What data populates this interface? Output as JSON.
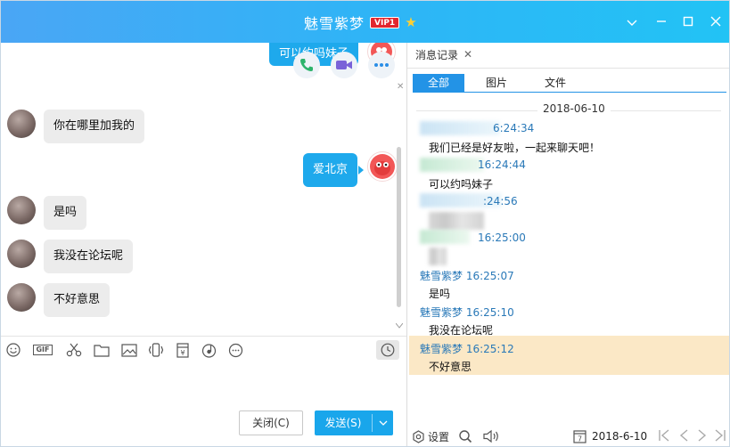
{
  "window": {
    "title": "魅雪紫梦",
    "vip_badge": "VIP1",
    "star_icon": "star-icon",
    "controls": [
      "chevron-down-icon",
      "minimize-icon",
      "maximize-icon",
      "close-icon"
    ]
  },
  "chat": {
    "call_buttons": [
      "phone-icon",
      "video-icon",
      "more-icon"
    ],
    "partial_top_message": "可以约吗妹子",
    "messages": [
      {
        "side": "left",
        "text": "你在哪里加我的"
      },
      {
        "side": "right",
        "text": "爱北京"
      },
      {
        "side": "left",
        "text": "是吗"
      },
      {
        "side": "left",
        "text": "我没在论坛呢"
      },
      {
        "side": "left",
        "text": "不好意思"
      }
    ]
  },
  "toolbar": {
    "icons": [
      "emoji-icon",
      "gif-icon",
      "scissors-icon",
      "folder-icon",
      "image-icon",
      "shake-icon",
      "red-packet-icon",
      "music-icon",
      "more-icon",
      "clock-icon"
    ],
    "gif_label": "GIF"
  },
  "input": {
    "close_label": "关闭(C)",
    "send_label": "发送(S)"
  },
  "history": {
    "tab_label": "消息记录",
    "filters": [
      "全部",
      "图片",
      "文件"
    ],
    "active_filter": "全部",
    "date_header": "2018-06-10",
    "entries": [
      {
        "sender": "",
        "time": "6:24:34",
        "content": "我们已经是好友啦，一起来聊天吧！"
      },
      {
        "sender": "",
        "time": "16:24:44",
        "content": "可以约吗妹子"
      },
      {
        "sender": "",
        "time": ":24:56",
        "content": ""
      },
      {
        "sender": "",
        "time": "16:25:00",
        "content": ""
      },
      {
        "sender": "魅雪紫梦",
        "time": "16:25:07",
        "content": "是吗"
      },
      {
        "sender": "魅雪紫梦",
        "time": "16:25:10",
        "content": "我没在论坛呢"
      },
      {
        "sender": "魅雪紫梦",
        "time": "16:25:12",
        "content": "不好意思"
      }
    ],
    "settings_label": "设置",
    "nav_date": "2018-6-10",
    "calendar_day": "7"
  }
}
